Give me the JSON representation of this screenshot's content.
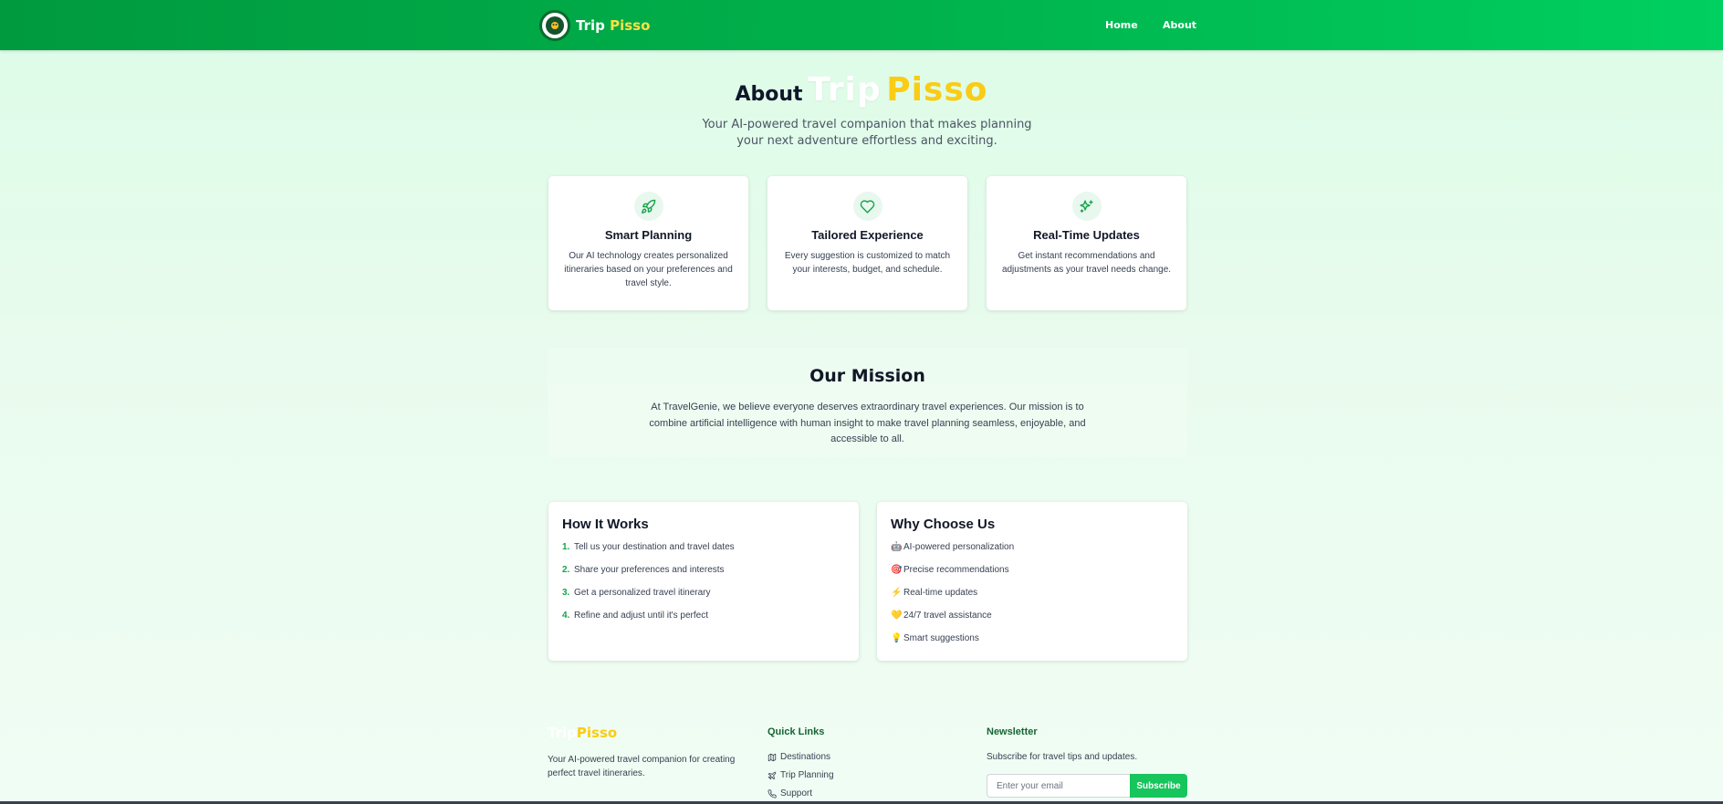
{
  "header": {
    "brand_main": "Trip",
    "brand_accent": "Pisso",
    "nav": [
      "Home",
      "About"
    ]
  },
  "hero": {
    "prefix": "About",
    "brand_main": "Trip",
    "brand_accent": "Pisso",
    "subtitle": "Your AI-powered travel companion that makes planning your next adventure effortless and exciting."
  },
  "features": [
    {
      "icon": "rocket-icon",
      "title": "Smart Planning",
      "desc": "Our AI technology creates personalized itineraries based on your preferences and travel style."
    },
    {
      "icon": "heart-icon",
      "title": "Tailored Experience",
      "desc": "Every suggestion is customized to match your interests, budget, and schedule."
    },
    {
      "icon": "sparkles-icon",
      "title": "Real-Time Updates",
      "desc": "Get instant recommendations and adjustments as your travel needs change."
    }
  ],
  "mission": {
    "title": "Our Mission",
    "text": "At TravelGenie, we believe everyone deserves extraordinary travel experiences. Our mission is to combine artificial intelligence with human insight to make travel planning seamless, enjoyable, and accessible to all."
  },
  "how_it_works": {
    "title": "How It Works",
    "steps": [
      {
        "num": "1.",
        "text": "Tell us your destination and travel dates"
      },
      {
        "num": "2.",
        "text": "Share your preferences and interests"
      },
      {
        "num": "3.",
        "text": "Get a personalized travel itinerary"
      },
      {
        "num": "4.",
        "text": "Refine and adjust until it's perfect"
      }
    ]
  },
  "why_choose_us": {
    "title": "Why Choose Us",
    "items": [
      {
        "emoji": "🤖",
        "text": "AI-powered personalization"
      },
      {
        "emoji": "🎯",
        "text": "Precise recommendations"
      },
      {
        "emoji": "⚡",
        "text": "Real-time updates"
      },
      {
        "emoji": "💛",
        "text": "24/7 travel assistance"
      },
      {
        "emoji": "💡",
        "text": "Smart suggestions"
      }
    ]
  },
  "footer": {
    "brand_main": "Trip",
    "brand_accent": "Pisso",
    "tagline": "Your AI-powered travel companion for creating perfect travel itineraries.",
    "quick_links_title": "Quick Links",
    "quick_links": [
      "Destinations",
      "Trip Planning",
      "Support"
    ],
    "newsletter_title": "Newsletter",
    "newsletter_text": "Subscribe for travel tips and updates.",
    "email_placeholder": "Enter your email",
    "subscribe_label": "Subscribe"
  },
  "colors": {
    "header_start": "#009a3e",
    "header_end": "#00d060",
    "accent_yellow": "#facc15",
    "accent_green": "#16a34a"
  }
}
